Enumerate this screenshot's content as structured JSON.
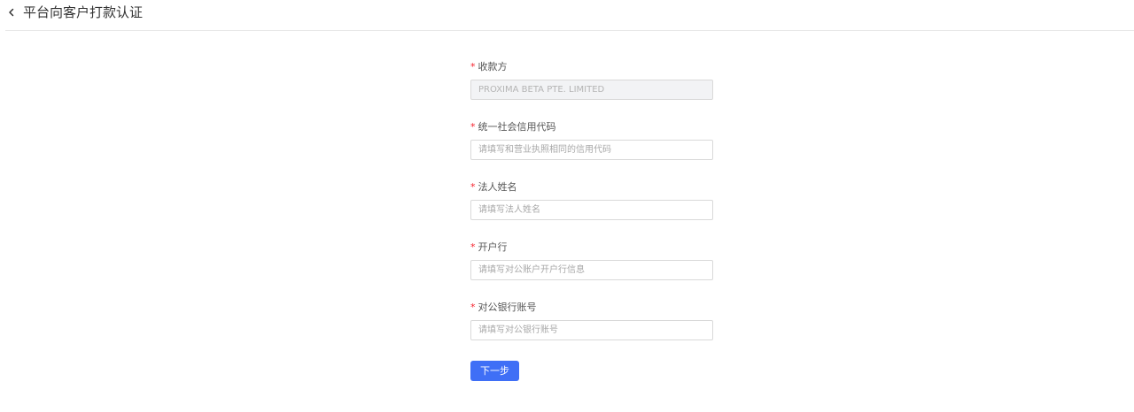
{
  "header": {
    "back_icon": "chevron-left-icon",
    "title": "平台向客户打款认证"
  },
  "form": {
    "payee": {
      "required": "*",
      "label": "收款方",
      "value": "PROXIMA BETA PTE. LIMITED",
      "disabled": true
    },
    "credit_code": {
      "required": "*",
      "label": "统一社会信用代码",
      "value": "",
      "placeholder": "请填写和营业执照相同的信用代码"
    },
    "legal_person": {
      "required": "*",
      "label": "法人姓名",
      "value": "",
      "placeholder": "请填写法人姓名"
    },
    "bank": {
      "required": "*",
      "label": "开户行",
      "value": "",
      "placeholder": "请填写对公账户开户行信息"
    },
    "bank_account": {
      "required": "*",
      "label": "对公银行账号",
      "value": "",
      "placeholder": "请填写对公银行账号"
    },
    "next_label": "下一步"
  },
  "colors": {
    "primary": "#3f6ff6",
    "required": "#f5222d",
    "disabled_bg": "#f2f3f5",
    "border": "#d9d9d9"
  }
}
